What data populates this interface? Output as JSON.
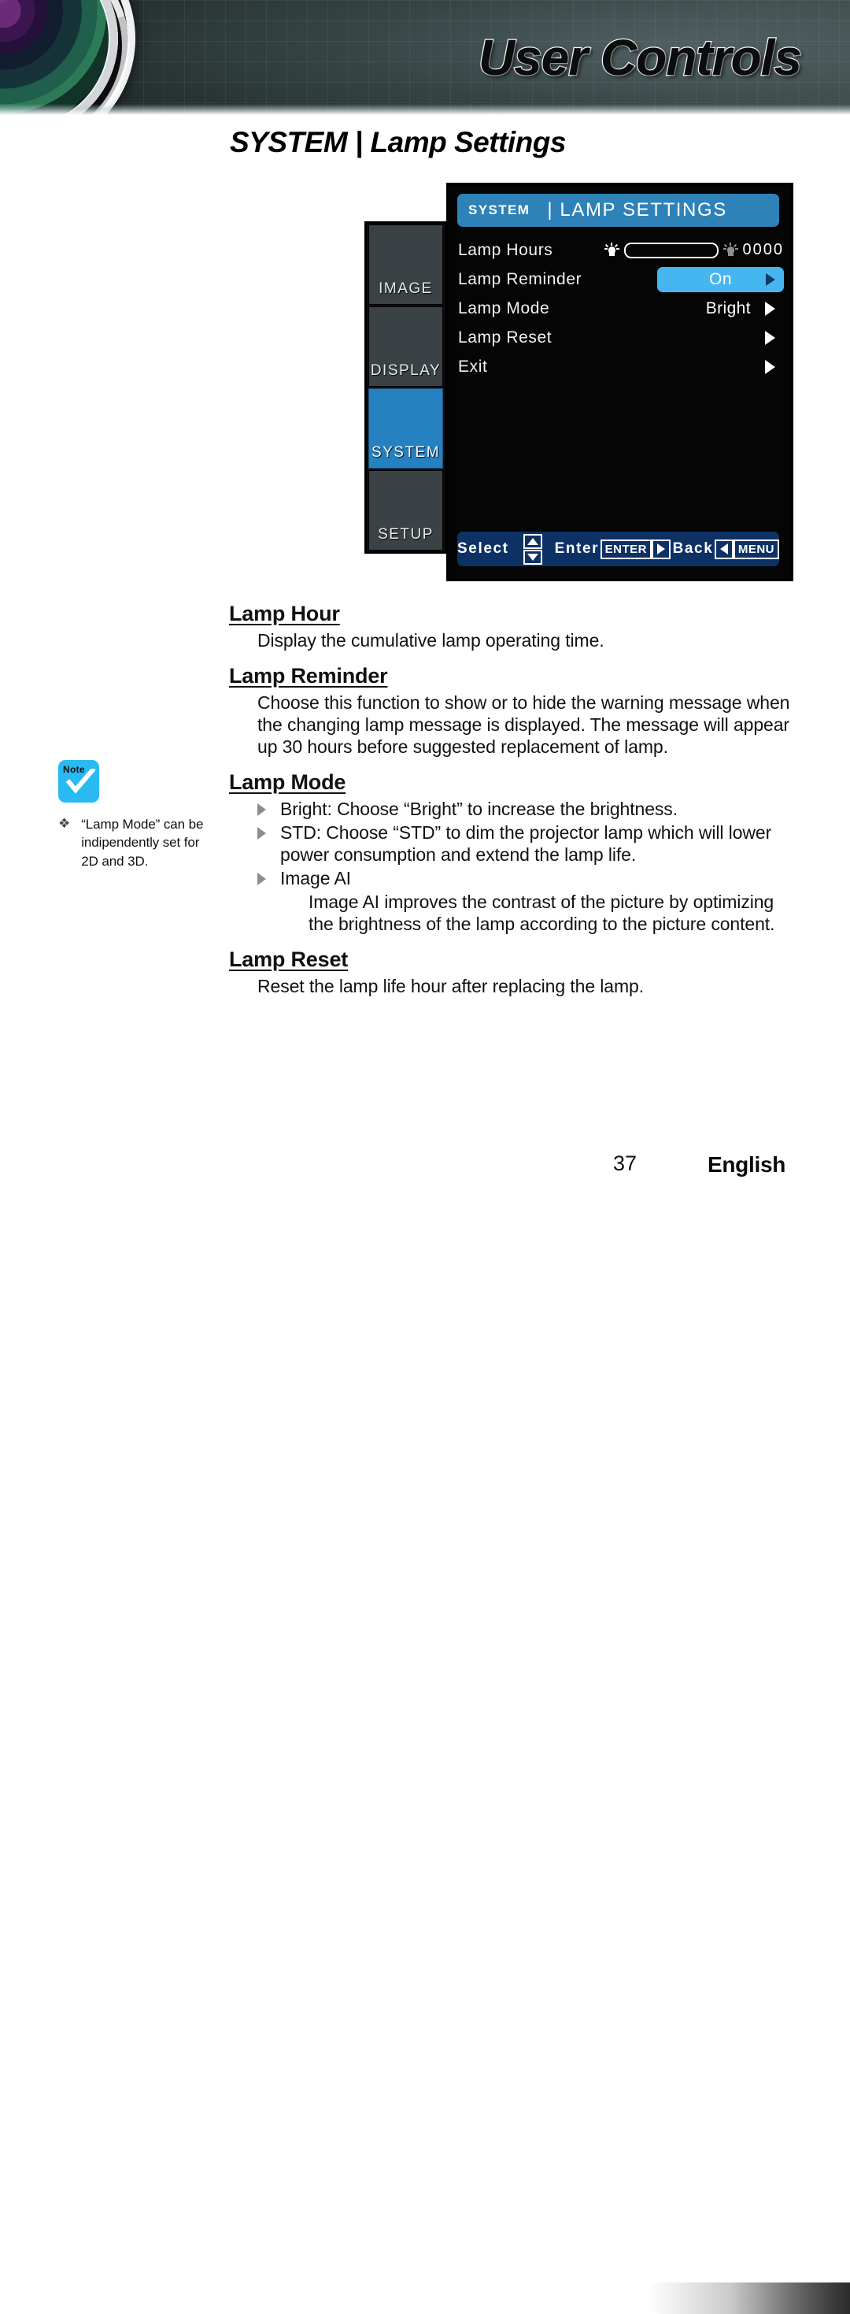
{
  "header": {
    "banner_title": "User Controls",
    "lens_icon": "projector-lens-photo"
  },
  "page_title": "SYSTEM | Lamp Settings",
  "osd": {
    "titlebar": {
      "category": "SYSTEM",
      "screen": "| LAMP SETTINGS"
    },
    "side_tabs": [
      {
        "label": "IMAGE",
        "active": false
      },
      {
        "label": "DISPLAY",
        "active": false
      },
      {
        "label": "SYSTEM",
        "active": true
      },
      {
        "label": "SETUP",
        "active": false
      }
    ],
    "rows": [
      {
        "label": "Lamp Hours",
        "value": "0000"
      },
      {
        "label": "Lamp Reminder",
        "value": "On"
      },
      {
        "label": "Lamp Mode",
        "value": "Bright"
      },
      {
        "label": "Lamp Reset",
        "value": ""
      },
      {
        "label": "Exit",
        "value": ""
      }
    ],
    "nav": {
      "select_label": "Select",
      "enter_label": "Enter",
      "enter_key": "ENTER",
      "back_label": "Back",
      "back_key": "MENU"
    },
    "colors": {
      "titlebar_blue": "#2e82b8",
      "highlight_blue": "#45b6f0",
      "active_tab_blue": "#2581c0",
      "navbar_navy": "#0d3165",
      "panel_black": "#050505"
    }
  },
  "content": {
    "s1_heading": "Lamp Hour",
    "s1_body": "Display the cumulative lamp operating time.",
    "s2_heading": "Lamp Reminder",
    "s2_body": "Choose this function to show or to hide the warning message when the changing lamp message is displayed. The message will appear up 30 hours before suggested replacement of lamp.",
    "s3_heading": "Lamp Mode",
    "s3_bullet1": "Bright: Choose “Bright” to increase the brightness.",
    "s3_bullet2": "STD: Choose “STD” to dim the projector lamp which will lower power consumption and extend the lamp life.",
    "s3_bullet3": "Image AI",
    "s3_bullet3_body": "Image AI improves the contrast of the picture by optimizing the brightness of the lamp according to the picture content.",
    "s4_heading": "Lamp Reset",
    "s4_body": "Reset the lamp life hour after replacing the lamp."
  },
  "note": {
    "icon_label": "Note",
    "bullet": "❖",
    "text": "“Lamp Mode” can be indipendently set for 2D and 3D."
  },
  "footer": {
    "page_number": "37",
    "language": "English"
  }
}
